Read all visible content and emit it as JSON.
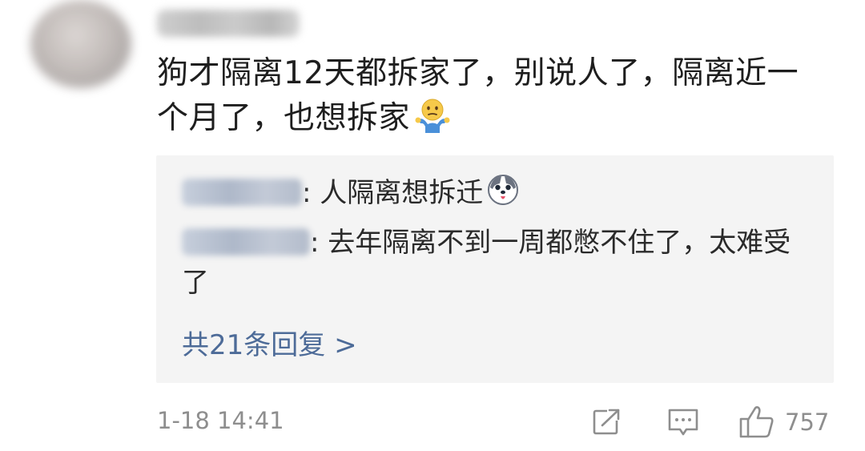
{
  "comment": {
    "text": "狗才隔离12天都拆家了，别说人了，隔离近一个月了，也想拆家",
    "emoji_icon": "shrug-emoji-icon"
  },
  "replies": [
    {
      "separator": ":",
      "text": " 人隔离想拆迁",
      "emoji_icon": "husky-dog-emoji-icon"
    },
    {
      "separator": ":",
      "text": " 去年隔离不到一周都憋不住了，太难受了"
    }
  ],
  "more_replies_label": "共21条回复 >",
  "meta": {
    "timestamp": "1-18 14:41",
    "like_count": "757"
  },
  "colors": {
    "link_blue": "#4d6b98",
    "meta_gray": "#8e8e8e",
    "reply_bg": "#f4f4f4"
  }
}
